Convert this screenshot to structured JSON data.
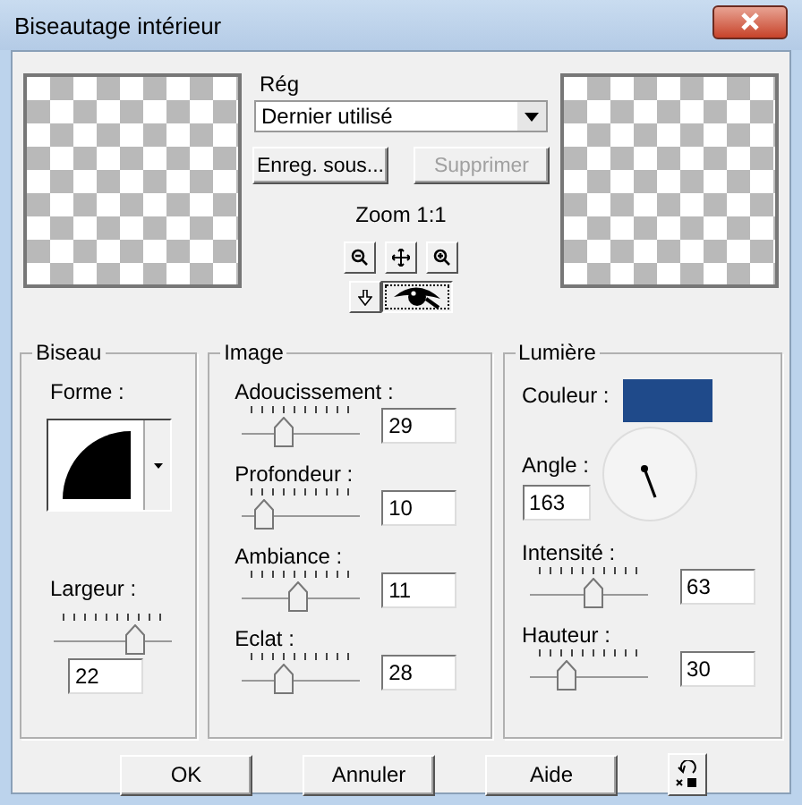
{
  "window": {
    "title": "Biseautage intérieur"
  },
  "presets": {
    "label": "Rég",
    "value": "Dernier utilisé"
  },
  "preset_buttons": [
    {
      "label": "Enreg. sous...",
      "disabled": false
    },
    {
      "label": "Supprimer",
      "disabled": true
    }
  ],
  "zoom": {
    "label": "Zoom 1:1"
  },
  "view_toggles": [
    {
      "kind": "arrow",
      "selected": false
    },
    {
      "kind": "eye",
      "selected": true
    }
  ],
  "biseau": {
    "title": "Biseau",
    "shape_label": "Forme :",
    "width": {
      "label": "Largeur :",
      "level": 0.72,
      "value": "22"
    }
  },
  "image": {
    "title": "Image",
    "sliders": [
      {
        "label": "Adoucissement :",
        "level": 0.32,
        "value": "29"
      },
      {
        "label": "Profondeur :",
        "level": 0.12,
        "value": "10"
      },
      {
        "label": "Ambiance :",
        "level": 0.47,
        "value": "11"
      },
      {
        "label": "Eclat :",
        "level": 0.32,
        "value": "28"
      }
    ]
  },
  "lumiere": {
    "title": "Lumière",
    "color_label": "Couleur :",
    "color": "#1f4a8a",
    "angle_label": "Angle :",
    "angle": "163",
    "sliders": [
      {
        "label": "Intensité :",
        "level": 0.55,
        "value": "63"
      },
      {
        "label": "Hauteur :",
        "level": 0.28,
        "value": "30"
      }
    ]
  },
  "buttons": [
    "OK",
    "Annuler",
    "Aide"
  ]
}
